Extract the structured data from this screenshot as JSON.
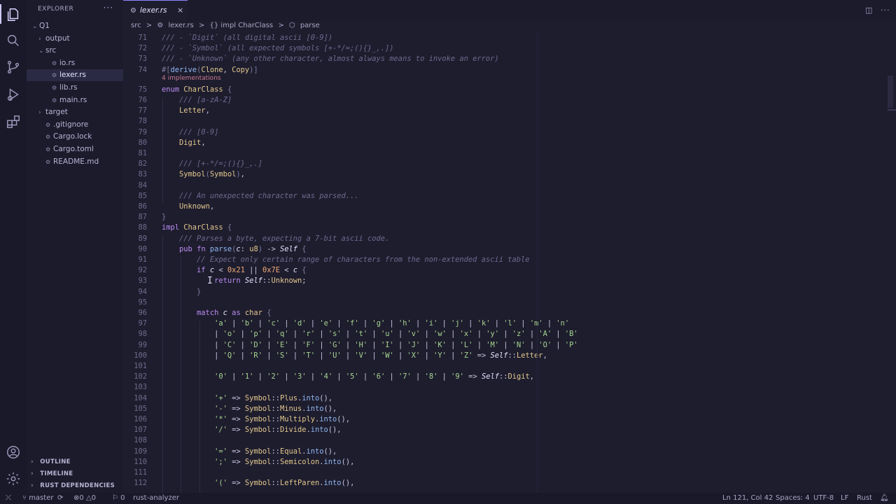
{
  "sidebar": {
    "title": "EXPLORER",
    "more": "···",
    "tree": [
      {
        "label": "Q1",
        "indent": 0,
        "chevron": "⌄",
        "selected": false
      },
      {
        "label": "output",
        "indent": 1,
        "chevron": "›",
        "selected": false
      },
      {
        "label": "src",
        "indent": 1,
        "chevron": "⌄",
        "selected": false
      },
      {
        "label": "io.rs",
        "indent": 2,
        "chevron": "",
        "selected": false,
        "file": true
      },
      {
        "label": "lexer.rs",
        "indent": 2,
        "chevron": "",
        "selected": true,
        "file": true
      },
      {
        "label": "lib.rs",
        "indent": 2,
        "chevron": "",
        "selected": false,
        "file": true
      },
      {
        "label": "main.rs",
        "indent": 2,
        "chevron": "",
        "selected": false,
        "file": true
      },
      {
        "label": "target",
        "indent": 1,
        "chevron": "›",
        "selected": false
      },
      {
        "label": ".gitignore",
        "indent": 1,
        "chevron": "",
        "selected": false,
        "file": true
      },
      {
        "label": "Cargo.lock",
        "indent": 1,
        "chevron": "",
        "selected": false,
        "file": true
      },
      {
        "label": "Cargo.toml",
        "indent": 1,
        "chevron": "",
        "selected": false,
        "file": true
      },
      {
        "label": "README.md",
        "indent": 1,
        "chevron": "",
        "selected": false,
        "file": true
      }
    ],
    "sections": [
      "OUTLINE",
      "TIMELINE",
      "RUST DEPENDENCIES"
    ]
  },
  "tab": {
    "label": "lexer.rs",
    "close": "×"
  },
  "breadcrumbs": [
    "src",
    ">",
    "lexer.rs",
    ">",
    "{} impl CharClass",
    ">",
    "parse"
  ],
  "implementations_hint": "4 implementations",
  "code_lines": [
    {
      "n": "71",
      "html": "<span class='cm'>/// - `Digit` (all digital ascii [0-9])</span>"
    },
    {
      "n": "72",
      "html": "<span class='cm'>/// - `Symbol` (all expected symbols [+-*/=;(){}_,.])</span>"
    },
    {
      "n": "73",
      "html": "<span class='cm'>/// - `Unknown` (any other character, almost always means to invoke an error)</span>"
    },
    {
      "n": "74",
      "html": "<span class='pn'>#[</span><span class='fn'>derive</span><span class='pn'>(</span><span class='ty'>Clone</span>, <span class='ty'>Copy</span><span class='pn'>)]</span>"
    },
    {
      "n": "75",
      "html": "<span class='kw'>enum</span> <span class='ty'>CharClass</span> <span class='pn'>{</span>"
    },
    {
      "n": "76",
      "html": "    <span class='cm'>/// [a-zA-Z]</span>"
    },
    {
      "n": "77",
      "html": "    <span class='ty'>Letter</span>,"
    },
    {
      "n": "78",
      "html": ""
    },
    {
      "n": "79",
      "html": "    <span class='cm'>/// [0-9]</span>"
    },
    {
      "n": "80",
      "html": "    <span class='ty'>Digit</span>,"
    },
    {
      "n": "81",
      "html": ""
    },
    {
      "n": "82",
      "html": "    <span class='cm'>/// [+-*/=;(){}_,.]</span>"
    },
    {
      "n": "83",
      "html": "    <span class='ty'>Symbol</span><span class='pn'>(</span><span class='ty'>Symbol</span><span class='pn'>)</span>,"
    },
    {
      "n": "84",
      "html": ""
    },
    {
      "n": "85",
      "html": "    <span class='cm'>/// An unexpected character was parsed...</span>"
    },
    {
      "n": "86",
      "html": "    <span class='ty'>Unknown</span>,"
    },
    {
      "n": "87",
      "html": "<span class='pn'>}</span>"
    },
    {
      "n": "88",
      "html": "<span class='kw'>impl</span> <span class='ty'>CharClass</span> <span class='pn'>{</span>"
    },
    {
      "n": "89",
      "html": "    <span class='cm'>/// Parses a byte, expecting a 7-bit ascii code.</span>"
    },
    {
      "n": "90",
      "html": "    <span class='kw'>pub</span> <span class='kw'>fn</span> <span class='fn'>parse</span><span class='pn'>(</span><span class='sf'>c</span>: <span class='ty'>u8</span><span class='pn'>)</span> -&gt; <span class='sf'>Self</span> <span class='pn'>{</span>"
    },
    {
      "n": "91",
      "html": "        <span class='cm'>// Expect only certain range of characters from the non-extended ascii table</span>"
    },
    {
      "n": "92",
      "html": "        <span class='kw'>if</span> <span class='sf'>c</span> &lt; <span class='nm'>0x21</span> || <span class='nm'>0x7E</span> &lt; <span class='sf'>c</span> <span class='pn'>{</span>"
    },
    {
      "n": "93",
      "html": "            <span class='kw'>return</span> <span class='sf'>Self</span>::<span class='ty'>Unknown</span>;"
    },
    {
      "n": "94",
      "html": "        <span class='pn'>}</span>"
    },
    {
      "n": "95",
      "html": ""
    },
    {
      "n": "96",
      "html": "        <span class='kw'>match</span> <span class='sf'>c</span> <span class='kw'>as</span> <span class='ty'>char</span> <span class='pn'>{</span>"
    },
    {
      "n": "97",
      "html": "            <span class='st'>'a'</span> | <span class='st'>'b'</span> | <span class='st'>'c'</span> | <span class='st'>'d'</span> | <span class='st'>'e'</span> | <span class='st'>'f'</span> | <span class='st'>'g'</span> | <span class='st'>'h'</span> | <span class='st'>'i'</span> | <span class='st'>'j'</span> | <span class='st'>'k'</span> | <span class='st'>'l'</span> | <span class='st'>'m'</span> | <span class='st'>'n'</span>"
    },
    {
      "n": "98",
      "html": "            | <span class='st'>'o'</span> | <span class='st'>'p'</span> | <span class='st'>'q'</span> | <span class='st'>'r'</span> | <span class='st'>'s'</span> | <span class='st'>'t'</span> | <span class='st'>'u'</span> | <span class='st'>'v'</span> | <span class='st'>'w'</span> | <span class='st'>'x'</span> | <span class='st'>'y'</span> | <span class='st'>'z'</span> | <span class='st'>'A'</span> | <span class='st'>'B'</span>"
    },
    {
      "n": "99",
      "html": "            | <span class='st'>'C'</span> | <span class='st'>'D'</span> | <span class='st'>'E'</span> | <span class='st'>'F'</span> | <span class='st'>'G'</span> | <span class='st'>'H'</span> | <span class='st'>'I'</span> | <span class='st'>'J'</span> | <span class='st'>'K'</span> | <span class='st'>'L'</span> | <span class='st'>'M'</span> | <span class='st'>'N'</span> | <span class='st'>'O'</span> | <span class='st'>'P'</span>"
    },
    {
      "n": "100",
      "html": "            | <span class='st'>'Q'</span> | <span class='st'>'R'</span> | <span class='st'>'S'</span> | <span class='st'>'T'</span> | <span class='st'>'U'</span> | <span class='st'>'V'</span> | <span class='st'>'W'</span> | <span class='st'>'X'</span> | <span class='st'>'Y'</span> | <span class='st'>'Z'</span> =&gt; <span class='sf'>Self</span>::<span class='ty'>Letter</span>,"
    },
    {
      "n": "101",
      "html": ""
    },
    {
      "n": "102",
      "html": "            <span class='st'>'0'</span> | <span class='st'>'1'</span> | <span class='st'>'2'</span> | <span class='st'>'3'</span> | <span class='st'>'4'</span> | <span class='st'>'5'</span> | <span class='st'>'6'</span> | <span class='st'>'7'</span> | <span class='st'>'8'</span> | <span class='st'>'9'</span> =&gt; <span class='sf'>Self</span>::<span class='ty'>Digit</span>,"
    },
    {
      "n": "103",
      "html": ""
    },
    {
      "n": "104",
      "html": "            <span class='st'>'+'</span> =&gt; <span class='ty'>Symbol</span>::<span class='ty'>Plus</span>.<span class='fn'>into</span>(),"
    },
    {
      "n": "105",
      "html": "            <span class='st'>'-'</span> =&gt; <span class='ty'>Symbol</span>::<span class='ty'>Minus</span>.<span class='fn'>into</span>(),"
    },
    {
      "n": "106",
      "html": "            <span class='st'>'*'</span> =&gt; <span class='ty'>Symbol</span>::<span class='ty'>Multiply</span>.<span class='fn'>into</span>(),"
    },
    {
      "n": "107",
      "html": "            <span class='st'>'/'</span> =&gt; <span class='ty'>Symbol</span>::<span class='ty'>Divide</span>.<span class='fn'>into</span>(),"
    },
    {
      "n": "108",
      "html": ""
    },
    {
      "n": "109",
      "html": "            <span class='st'>'='</span> =&gt; <span class='ty'>Symbol</span>::<span class='ty'>Equal</span>.<span class='fn'>into</span>(),"
    },
    {
      "n": "110",
      "html": "            <span class='st'>';'</span> =&gt; <span class='ty'>Symbol</span>::<span class='ty'>Semicolon</span>.<span class='fn'>into</span>(),"
    },
    {
      "n": "111",
      "html": ""
    },
    {
      "n": "112",
      "html": "            <span class='st'>'('</span> =&gt; <span class='ty'>Symbol</span>::<span class='ty'>LeftParen</span>.<span class='fn'>into</span>(),"
    }
  ],
  "status": {
    "branch": "master",
    "sync": "⟳",
    "errors": "0",
    "warnings": "0",
    "info": "0",
    "rust_analyzer": "rust-analyzer",
    "position": "Ln 121, Col 42",
    "spaces": "Spaces: 4",
    "encoding": "UTF-8",
    "eol": "LF",
    "language": "Rust"
  },
  "colors": {
    "accent": "#8f87ff",
    "background": "#1e1d2e"
  }
}
